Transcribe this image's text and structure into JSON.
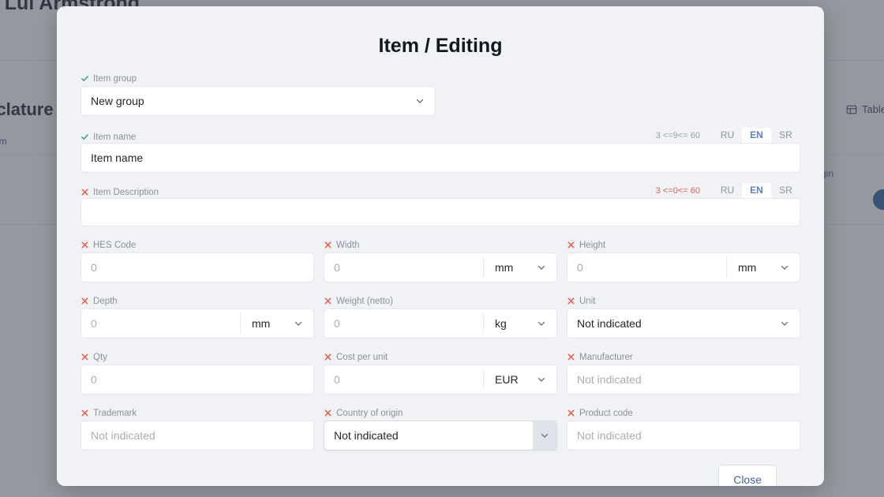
{
  "background": {
    "breadcrumb": "/ / Lui Armstrong",
    "section_title": "nclature",
    "add_link": "em",
    "table_button": "Table",
    "column_header": "f origin"
  },
  "modal": {
    "title": "Item / Editing",
    "item_group": {
      "label": "Item group",
      "status": "valid",
      "value": "New group"
    },
    "item_name": {
      "label": "Item name",
      "status": "valid",
      "counter": "3 <=9<= 60",
      "counter_state": "ok",
      "value": "Item name",
      "languages": [
        "RU",
        "EN",
        "SR"
      ],
      "active_language": "EN"
    },
    "item_description": {
      "label": "Item Description",
      "status": "invalid",
      "counter": "3 <=0<= 60",
      "counter_state": "bad",
      "value": "",
      "languages": [
        "RU",
        "EN",
        "SR"
      ],
      "active_language": "EN"
    },
    "fields": [
      {
        "label": "HES Code",
        "status": "invalid",
        "placeholder": "0",
        "value": "",
        "kind": "text"
      },
      {
        "label": "Width",
        "status": "invalid",
        "placeholder": "0",
        "value": "",
        "kind": "unit",
        "unit": "mm"
      },
      {
        "label": "Height",
        "status": "invalid",
        "placeholder": "0",
        "value": "",
        "kind": "unit",
        "unit": "mm"
      },
      {
        "label": "Depth",
        "status": "invalid",
        "placeholder": "0",
        "value": "",
        "kind": "unit",
        "unit": "mm"
      },
      {
        "label": "Weight (netto)",
        "status": "invalid",
        "placeholder": "0",
        "value": "",
        "kind": "unit",
        "unit": "kg"
      },
      {
        "label": "Unit",
        "status": "invalid",
        "placeholder": "",
        "value": "Not indicated",
        "kind": "select"
      },
      {
        "label": "Qty",
        "status": "invalid",
        "placeholder": "0",
        "value": "",
        "kind": "text"
      },
      {
        "label": "Cost per unit",
        "status": "invalid",
        "placeholder": "0",
        "value": "",
        "kind": "unit",
        "unit": "EUR"
      },
      {
        "label": "Manufacturer",
        "status": "invalid",
        "placeholder": "Not indicated",
        "value": "",
        "kind": "text"
      },
      {
        "label": "Trademark",
        "status": "invalid",
        "placeholder": "Not indicated",
        "value": "",
        "kind": "text"
      },
      {
        "label": "Country of origin",
        "status": "invalid",
        "placeholder": "",
        "value": "Not indicated",
        "kind": "select-focused"
      },
      {
        "label": "Product code",
        "status": "invalid",
        "placeholder": "Not indicated",
        "value": "",
        "kind": "text"
      }
    ],
    "close_label": "Close"
  },
  "colors": {
    "valid": "#3aa76d",
    "invalid": "#e05b4c",
    "accent": "#5a7fc4",
    "modal_bg": "#f1f2f6",
    "overlay": "#424854"
  }
}
